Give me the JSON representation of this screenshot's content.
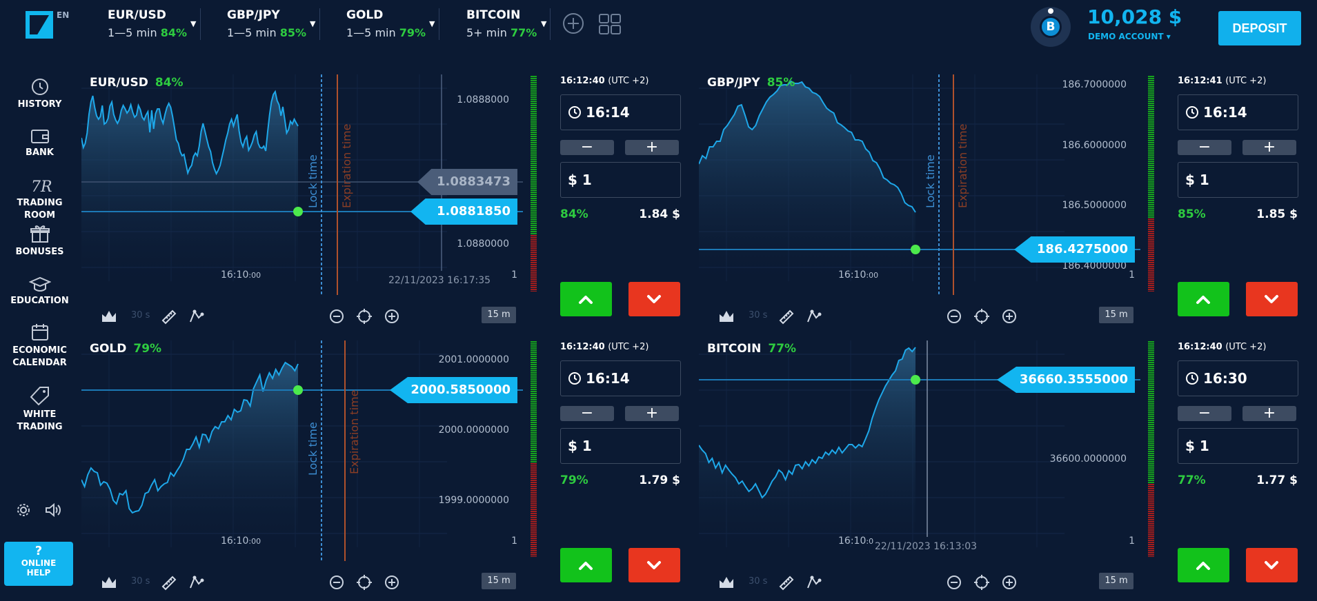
{
  "header": {
    "lang": "EN",
    "assets": [
      {
        "name": "EUR/USD",
        "duration": "1—5 min",
        "payout": "84%"
      },
      {
        "name": "GBP/JPY",
        "duration": "1—5 min",
        "payout": "85%"
      },
      {
        "name": "GOLD",
        "duration": "1—5 min",
        "payout": "79%"
      },
      {
        "name": "BITCOIN",
        "duration": "5+ min",
        "payout": "77%"
      }
    ],
    "avatar_letter": "B",
    "balance": "10,028 $",
    "account": "DEMO ACCOUNT ▾",
    "deposit": "DEPOSIT"
  },
  "sidebar": {
    "items": [
      {
        "label": "HISTORY",
        "icon": "history-icon"
      },
      {
        "label": "BANK",
        "icon": "wallet-icon"
      },
      {
        "label": "TRADING ROOM",
        "icon": "trading-room-icon"
      },
      {
        "label": "BONUSES",
        "icon": "gift-icon"
      },
      {
        "label": "EDUCATION",
        "icon": "graduation-cap-icon"
      },
      {
        "label": "ECONOMIC",
        "label2": "CALENDAR",
        "icon": "calendar-icon"
      },
      {
        "label": "WHITE",
        "label2": "TRADING",
        "icon": "tag-icon"
      }
    ],
    "help_q": "?",
    "help_line1": "ONLINE",
    "help_line2": "HELP"
  },
  "panels": [
    {
      "title": "EUR/USD",
      "payout": "84%",
      "axis": [
        "1.0888000",
        "1.0880000",
        "1"
      ],
      "time_label": "16:10",
      "time_small": ":00",
      "date_label": "22/11/2023 16:17:35",
      "lock": "Lock time",
      "expiration": "Expiration time",
      "price": "1.0881850",
      "ghost_price": "1.0883473",
      "interval": "30 s",
      "timeframe": "15 m",
      "clock": "16:12:40",
      "tz": "(UTC +2)",
      "expiry": "16:14",
      "amount": "$ 1",
      "pay_pct": "84%",
      "pay_amt": "1.84 $",
      "series": [
        198,
        184,
        190,
        205,
        232,
        250,
        259,
        242,
        230,
        225,
        229,
        245,
        218,
        220,
        226,
        244,
        250,
        232,
        224,
        219,
        225,
        238,
        245,
        240,
        234,
        238,
        246,
        235,
        228,
        231,
        245,
        239,
        228,
        224,
        231,
        236,
        206,
        238,
        211,
        233,
        240,
        240,
        226,
        219,
        232,
        242,
        248,
        242,
        229,
        212,
        195,
        190,
        178,
        172,
        174,
        160,
        147,
        154,
        158,
        171,
        176,
        172,
        186,
        207,
        219,
        208,
        196,
        185,
        178,
        162,
        153,
        146,
        151,
        158,
        170,
        182,
        195,
        205,
        218,
        225,
        215,
        224,
        232,
        208,
        192,
        185,
        195,
        200,
        180,
        185,
        192,
        202,
        207,
        190,
        184,
        183,
        186,
        179,
        206,
        231,
        250,
        261,
        265,
        252,
        246,
        230,
        243,
        225,
        205,
        210,
        222,
        218,
        225,
        220,
        215
      ]
    },
    {
      "title": "GBP/JPY",
      "payout": "85%",
      "axis": [
        "186.7000000",
        "186.6000000",
        "186.5000000",
        "186.4000000",
        "1"
      ],
      "time_label": "16:10",
      "time_small": ":00",
      "lock": "Lock time",
      "expiration": "Expiration time",
      "price": "186.4275000",
      "interval": "30 s",
      "timeframe": "15 m",
      "clock": "16:12:41",
      "tz": "(UTC +2)",
      "expiry": "16:14",
      "amount": "$ 1",
      "pay_pct": "85%",
      "pay_amt": "1.85 $",
      "series": [
        160,
        172,
        168,
        185,
        185,
        193,
        193,
        210,
        216,
        224,
        232,
        244,
        246,
        231,
        214,
        210,
        216,
        230,
        240,
        250,
        257,
        261,
        266,
        274,
        275,
        275,
        280,
        277,
        277,
        279,
        272,
        270,
        264,
        262,
        258,
        249,
        241,
        237,
        234,
        220,
        217,
        213,
        208,
        206,
        195,
        195,
        193,
        182,
        177,
        165,
        162,
        153,
        140,
        137,
        132,
        130,
        126,
        117,
        104,
        100,
        98,
        90
      ]
    },
    {
      "title": "GOLD",
      "payout": "79%",
      "axis": [
        "2001.0000000",
        "2000.0000000",
        "1999.0000000",
        "1"
      ],
      "time_label": "16:10",
      "time_small": ":00",
      "lock": "Lock time",
      "expiration": "Expiration time",
      "price": "2000.5850000",
      "interval": "30 s",
      "timeframe": "15 m",
      "clock": "16:12:40",
      "tz": "(UTC +2)",
      "expiry": "16:14",
      "amount": "$ 1",
      "pay_pct": "79%",
      "pay_amt": "1.79 $",
      "series": [
        88,
        78,
        95,
        105,
        100,
        98,
        80,
        85,
        83,
        74,
        58,
        53,
        68,
        66,
        72,
        46,
        40,
        42,
        43,
        51,
        68,
        70,
        80,
        88,
        72,
        78,
        82,
        84,
        98,
        93,
        101,
        108,
        118,
        132,
        132,
        140,
        150,
        135,
        154,
        153,
        143,
        158,
        165,
        162,
        172,
        172,
        181,
        175,
        190,
        186,
        188,
        204,
        203,
        195,
        220,
        230,
        240,
        216,
        232,
        243,
        235,
        248,
        240,
        250,
        258,
        255,
        252,
        246,
        256
      ]
    },
    {
      "title": "BITCOIN",
      "payout": "77%",
      "axis": [
        "36600.0000000",
        "1"
      ],
      "time_label": "16:10",
      "time_small": ":0",
      "date_label": "22/11/2023 16:13:03",
      "price": "36660.3555000",
      "interval": "30 s",
      "timeframe": "15 m",
      "clock": "16:12:40",
      "tz": "(UTC +2)",
      "expiry": "16:30",
      "amount": "$ 1",
      "pay_pct": "77%",
      "pay_amt": "1.77 $",
      "series": [
        138,
        131,
        126,
        113,
        119,
        105,
        113,
        98,
        109,
        102,
        96,
        91,
        82,
        86,
        78,
        71,
        75,
        82,
        72,
        62,
        67,
        76,
        86,
        92,
        102,
        98,
        88,
        101,
        96,
        109,
        110,
        104,
        114,
        108,
        117,
        112,
        121,
        119,
        128,
        124,
        131,
        126,
        135,
        127,
        133,
        139,
        139,
        134,
        139,
        136,
        147,
        159,
        177,
        191,
        204,
        214,
        224,
        232,
        240,
        246,
        261,
        263,
        276,
        279,
        274,
        280
      ]
    }
  ],
  "colors": {
    "bg": "#0b1a33",
    "accent": "#12b5f0",
    "up": "#12c21b",
    "down": "#e8361f",
    "payout": "#2ecc40"
  }
}
